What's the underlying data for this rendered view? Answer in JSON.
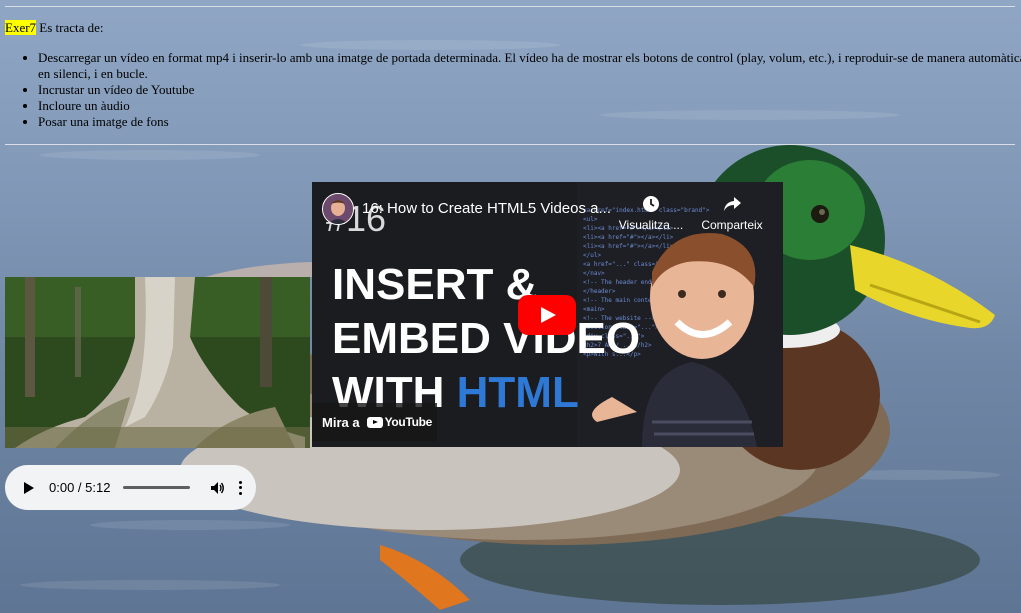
{
  "intro": {
    "highlight": "Exer7",
    "text": " Es tracta de:"
  },
  "tasks": [
    "Descarregar un vídeo en format mp4 i inserir-lo amb una imatge de portada determinada. El vídeo ha de mostrar els botons de control (play, volum, etc.), i reproduir-se de manera automàtica, en silenci, i en bucle.",
    "Incrustar un vídeo de Youtube",
    "Incloure un àudio",
    "Posar una imatge de fons"
  ],
  "youtube": {
    "title": "16: How to Create HTML5 Videos a...",
    "episode": "#16",
    "headline_1": "INSERT &",
    "headline_2": "EMBED VIDEO",
    "headline_3a": "WITH ",
    "headline_3b": "HTML",
    "watch_later": "Visualitza ...",
    "share": "Comparteix",
    "watch_on": "Mira a",
    "brand": "YouTube",
    "code_lines": [
      "<a href=\"index.html\" class=\"brand\">",
      "<ul>",
      "  <li><a href=\"#\"></a></li>",
      "  <li><a href=\"#\"></a></li>",
      "  <li><a href=\"#\"></a></li>",
      "</ul>",
      "<a href=\"...\" class=\"...\">",
      "</nav>",
      "<!-- The header end -->",
      "</header>",
      "",
      "<!-- The main content -->",
      "<main>",
      "<!-- The website -->",
      "<section class=\"...\">",
      "  <div class=\"...\">",
      "    <h2>7 AM / ...</h2>",
      "    <p>With s...</p>"
    ]
  },
  "audio": {
    "time": "0:00 / 5:12",
    "progress": 0
  }
}
